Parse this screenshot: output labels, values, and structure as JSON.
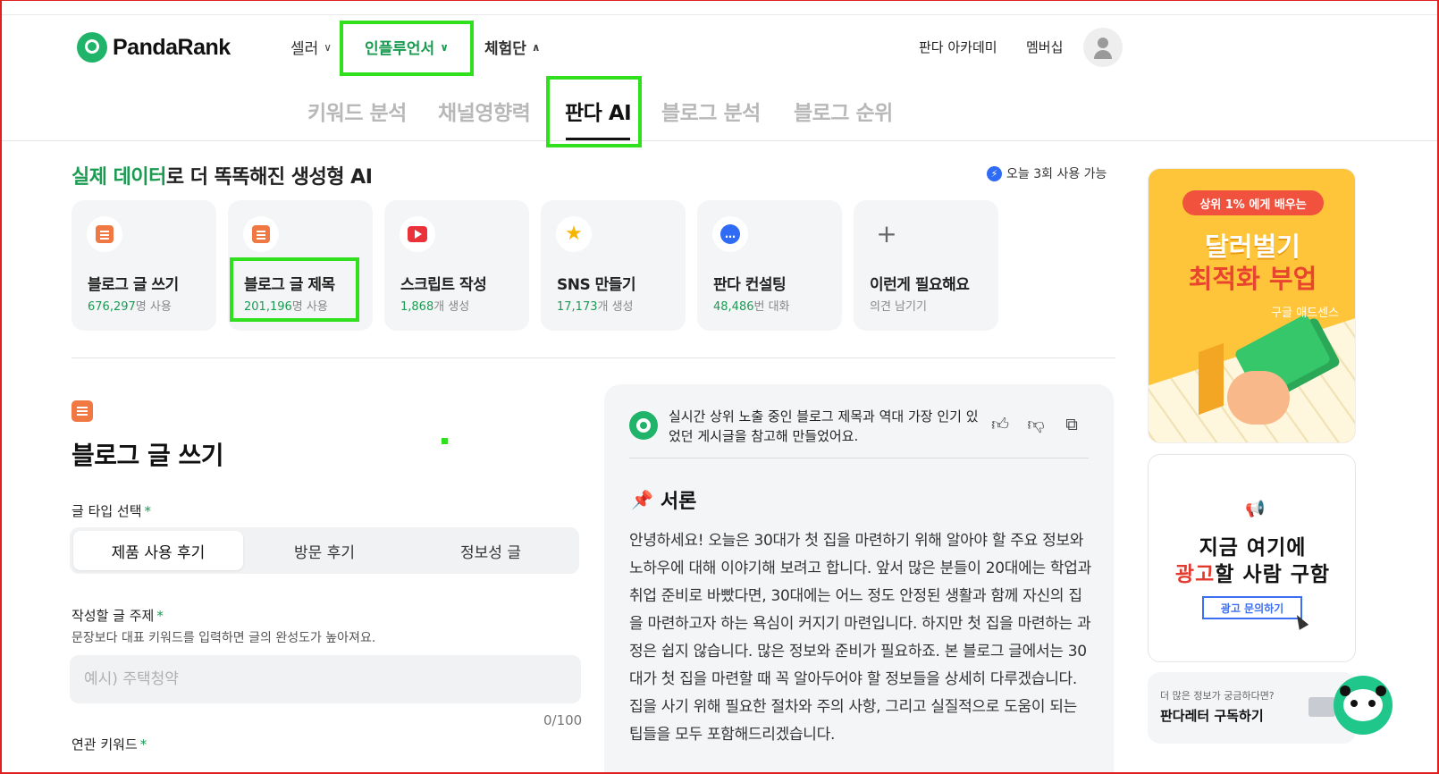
{
  "header": {
    "brand": "PandaRank",
    "nav": [
      {
        "label": "셀러"
      },
      {
        "label": "인플루언서"
      },
      {
        "label": "체험단"
      }
    ],
    "links": [
      "판다 아카데미",
      "멤버십"
    ]
  },
  "tabs": [
    "키워드 분석",
    "채널영향력",
    "판다 AI",
    "블로그 분석",
    "블로그 순위"
  ],
  "headline": {
    "accent": "실제 데이터",
    "rest": "로 더 똑똑해진 생성형 AI"
  },
  "usage": "오늘 3회 사용 가능",
  "cards": [
    {
      "title": "블로그 글 쓰기",
      "num": "676,297",
      "unit": "명 사용",
      "icon": "doc-icon"
    },
    {
      "title": "블로그 글 제목",
      "num": "201,196",
      "unit": "명 사용",
      "icon": "list-icon"
    },
    {
      "title": "스크립트 작성",
      "num": "1,868",
      "unit": "개 생성",
      "icon": "play-icon"
    },
    {
      "title": "SNS 만들기",
      "num": "17,173",
      "unit": "개 생성",
      "icon": "star-icon"
    },
    {
      "title": "판다 컨설팅",
      "num": "48,486",
      "unit": "번 대화",
      "icon": "chat-icon"
    },
    {
      "title": "이런게 필요해요",
      "num": "",
      "unit": "의견 남기기",
      "icon": "plus-icon"
    }
  ],
  "form": {
    "title": "블로그 글 쓰기",
    "type_label": "글 타입 선택",
    "req": "*",
    "types": [
      "제품 사용 후기",
      "방문 후기",
      "정보성 글"
    ],
    "topic_label": "작성할 글 주제",
    "topic_helper": "문장보다 대표 키워드를 입력하면 글의 완성도가 높아져요.",
    "topic_placeholder": "예시) 주택청약",
    "counter": "0/100",
    "keyword_label": "연관 키워드"
  },
  "panel": {
    "desc": "실시간 상위 노출 중인 블로그 제목과 역대 가장 인기 있었던 게시글을 참고해 만들었어요.",
    "section_title": "서론",
    "body": "안녕하세요! 오늘은 30대가 첫 집을 마련하기 위해 알아야 할 주요 정보와 노하우에 대해 이야기해 보려고 합니다. 앞서 많은 분들이 20대에는 학업과 취업 준비로 바빴다면, 30대에는 어느 정도 안정된 생활과 함께 자신의 집을 마련하고자 하는 욕심이 커지기 마련입니다. 하지만 첫 집을 마련하는 과정은 쉽지 않습니다. 많은 정보와 준비가 필요하죠. 본 블로그 글에서는 30대가 첫 집을 마련할 때 꼭 알아두어야 할 정보들을 상세히 다루겠습니다. 집을 사기 위해 필요한 절차와 주의 사항, 그리고 실질적으로 도움이 되는 팁들을 모두 포함해드리겠습니다."
  },
  "ads": {
    "ad1": {
      "badge": "상위 1% 에게 배우는",
      "line1": "달러벌기",
      "line2": "최적화 부업",
      "sub": "구글 애드센스"
    },
    "ad2": {
      "line1": "지금 여기에",
      "line2_red": "광고",
      "line2_rest": "할 사람 구함",
      "button": "광고 문의하기"
    }
  },
  "newsletter": {
    "small": "더 많은 정보가 궁금하다면?",
    "big": "판다레터 구독하기"
  }
}
